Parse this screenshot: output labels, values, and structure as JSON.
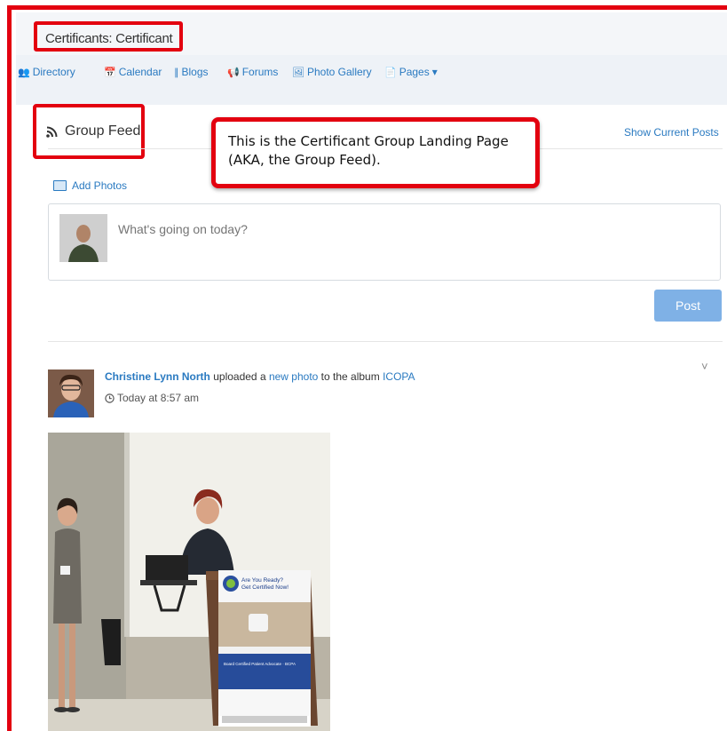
{
  "group": {
    "title": "Certificants: Certificant"
  },
  "nav": [
    {
      "label": "Directory",
      "icon": "users-icon",
      "glyph": "👥"
    },
    {
      "label": "Calendar",
      "icon": "calendar-icon",
      "glyph": "📅"
    },
    {
      "label": "Blogs",
      "icon": "rss-icon",
      "glyph": "∥"
    },
    {
      "label": "Forums",
      "icon": "bullhorn-icon",
      "glyph": "📢"
    },
    {
      "label": "Photo Gallery",
      "icon": "image-icon",
      "glyph": "🖼"
    },
    {
      "label": "Pages",
      "icon": "page-icon",
      "glyph": "📄",
      "dropdown": "▾"
    }
  ],
  "feed": {
    "title": "Group Feed",
    "show_current": "Show Current Posts",
    "add_photos": "Add Photos",
    "composer_placeholder": "What's going on today?",
    "post_button": "Post"
  },
  "callout": {
    "text": "This is the Certificant Group Landing Page (AKA, the Group Feed)."
  },
  "post": {
    "author": "Christine Lynn North",
    "action_1": " uploaded a ",
    "link_1": "new photo",
    "action_2": " to the album ",
    "album": "ICOPA",
    "time": "Today at 8:57 am",
    "chevron": "˅"
  },
  "banner": {
    "line1": "Are You Ready?",
    "line2": "Get Certified Now!",
    "line3": "Board Certified Patient Advocate · BCPA"
  },
  "colors": {
    "accent": "#2a7ac1",
    "callout_border": "#e3000f",
    "post_button": "#7fb1e6"
  }
}
